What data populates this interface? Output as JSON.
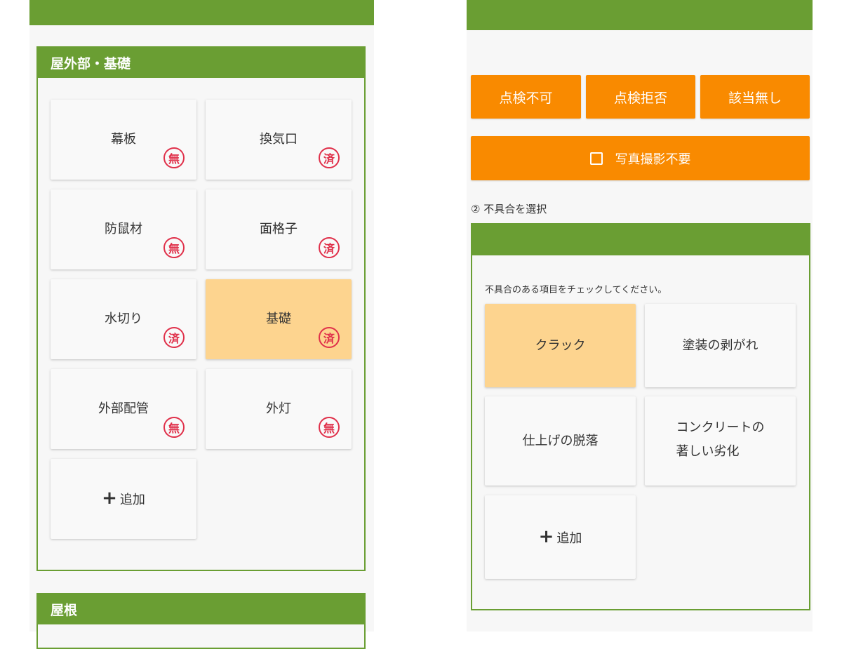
{
  "left_panel": {
    "section_exterior": {
      "title": "屋外部・基礎",
      "items": [
        {
          "label": "幕板",
          "status": "無",
          "selected": false
        },
        {
          "label": "換気口",
          "status": "済",
          "selected": false
        },
        {
          "label": "防鼠材",
          "status": "無",
          "selected": false
        },
        {
          "label": "面格子",
          "status": "済",
          "selected": false
        },
        {
          "label": "水切り",
          "status": "済",
          "selected": false
        },
        {
          "label": "基礎",
          "status": "済",
          "selected": true
        },
        {
          "label": "外部配管",
          "status": "無",
          "selected": false
        },
        {
          "label": "外灯",
          "status": "無",
          "selected": false
        }
      ],
      "add_label": "追加"
    },
    "section_roof": {
      "title": "屋根"
    }
  },
  "right_panel": {
    "buttons": {
      "cannot_inspect": "点検不可",
      "refused": "点検拒否",
      "not_applicable": "該当無し"
    },
    "photo_not_required": {
      "label": "写真撮影不要",
      "checked": false
    },
    "step_label": "② 不具合を選択",
    "defect_section": {
      "title": "",
      "instruction": "不具合のある項目をチェックしてください。",
      "items": [
        {
          "label": "クラック",
          "selected": true
        },
        {
          "label": "塗装の剥がれ",
          "selected": false
        },
        {
          "label": "仕上げの脱落",
          "selected": false
        },
        {
          "label_line1": "コンクリートの",
          "label_line2": "著しい劣化",
          "selected": false
        }
      ],
      "add_label": "追加"
    }
  },
  "colors": {
    "green": "#6a9e33",
    "orange": "#f98a00",
    "selected": "#fdd48f",
    "stamp_red": "#e0304a",
    "panel_bg": "#f7f7f7"
  }
}
